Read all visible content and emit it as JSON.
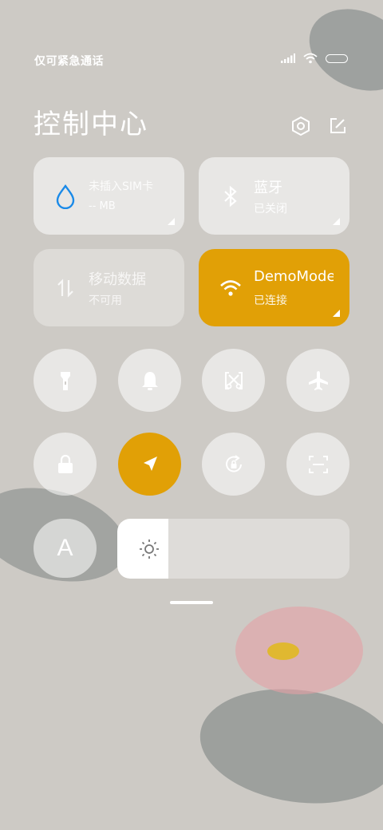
{
  "status_bar": {
    "carrier_text": "仅可紧急通话",
    "icons": [
      "signal-icon",
      "wifi-icon",
      "battery-icon"
    ]
  },
  "header": {
    "title": "控制中心",
    "icons": [
      "settings-icon",
      "edit-icon"
    ]
  },
  "tiles": {
    "data_usage": {
      "title": "未插入SIM卡",
      "subtitle": "-- MB",
      "icon": "water-drop-icon"
    },
    "bluetooth": {
      "title": "蓝牙",
      "subtitle": "已关闭",
      "icon": "bluetooth-icon"
    },
    "mobile_data": {
      "title": "移动数据",
      "subtitle": "不可用",
      "icon": "data-arrows-icon"
    },
    "wifi": {
      "title": "DemoMode",
      "subtitle": "已连接",
      "icon": "wifi-icon"
    }
  },
  "toggles": [
    {
      "icon": "flashlight-icon",
      "active": false
    },
    {
      "icon": "bell-icon",
      "active": false
    },
    {
      "icon": "screenshot-icon",
      "active": false
    },
    {
      "icon": "airplane-icon",
      "active": false
    },
    {
      "icon": "lock-icon",
      "active": false
    },
    {
      "icon": "location-icon",
      "active": true
    },
    {
      "icon": "auto-rotate-icon",
      "active": false
    },
    {
      "icon": "scanner-icon",
      "active": false
    }
  ],
  "font_button": {
    "label": "A"
  },
  "brightness": {
    "level": 0.22,
    "icon": "sun-icon"
  },
  "colors": {
    "accent": "#e1a006",
    "background": "#cdcac5"
  }
}
